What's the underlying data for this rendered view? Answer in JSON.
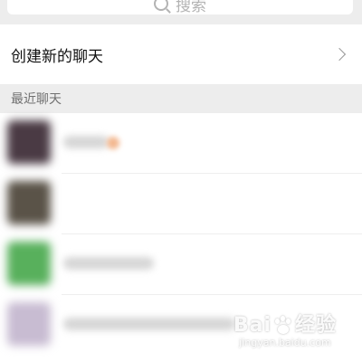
{
  "search": {
    "label": "搜索",
    "icon": "search-icon"
  },
  "create_chat": {
    "label": "创建新的聊天",
    "icon": "chevron-right-icon"
  },
  "recent_section": {
    "title": "最近聊天"
  },
  "chats": [
    {
      "avatar_color": "#4a3a44",
      "name_width_frac": 0.42,
      "has_dot": true
    },
    {
      "avatar_color": "#5a5348",
      "name_width_frac": 0.0,
      "has_dot": false
    },
    {
      "avatar_color": "#58b05c",
      "name_width_frac": 0.62,
      "has_dot": false
    },
    {
      "avatar_color": "#c8bcd2",
      "name_width_frac": 1.0,
      "has_dot": false
    }
  ],
  "watermark": {
    "brand_left": "Bai",
    "brand_right": "经验",
    "domain": "jingyan.baidu.com"
  },
  "colors": {
    "page_bg": "#ededed",
    "card_bg": "#ffffff",
    "text_primary": "#111111",
    "text_secondary": "#707070"
  }
}
